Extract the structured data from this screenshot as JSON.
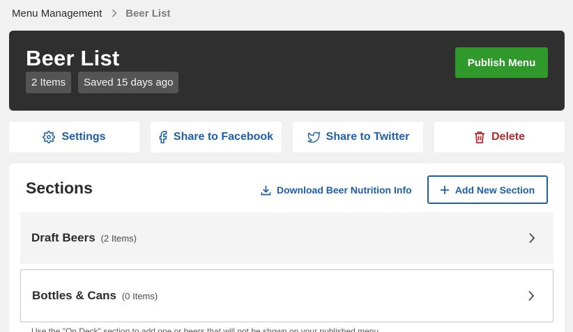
{
  "breadcrumb": {
    "parent": "Menu Management",
    "current": "Beer List"
  },
  "header": {
    "title": "Beer List",
    "items_badge": "2 Items",
    "saved_badge": "Saved 15 days ago",
    "publish_label": "Publish Menu"
  },
  "actions": {
    "settings": "Settings",
    "facebook": "Share to Facebook",
    "twitter": "Share to Twitter",
    "delete": "Delete"
  },
  "sections": {
    "title": "Sections",
    "download_label": "Download Beer Nutrition Info",
    "add_label": "Add New Section",
    "items": [
      {
        "name": "Draft Beers",
        "count": "(2 Items)"
      },
      {
        "name": "Bottles & Cans",
        "count": "(0 Items)"
      }
    ],
    "footnote": "Use the \"On Deck\" section to add one or beers that will not be shown on your published menu."
  },
  "colors": {
    "header_bg": "#2f2f2f",
    "publish": "#2f9a2b",
    "link_blue": "#1d5fa8",
    "delete_red": "#b02b2b"
  }
}
